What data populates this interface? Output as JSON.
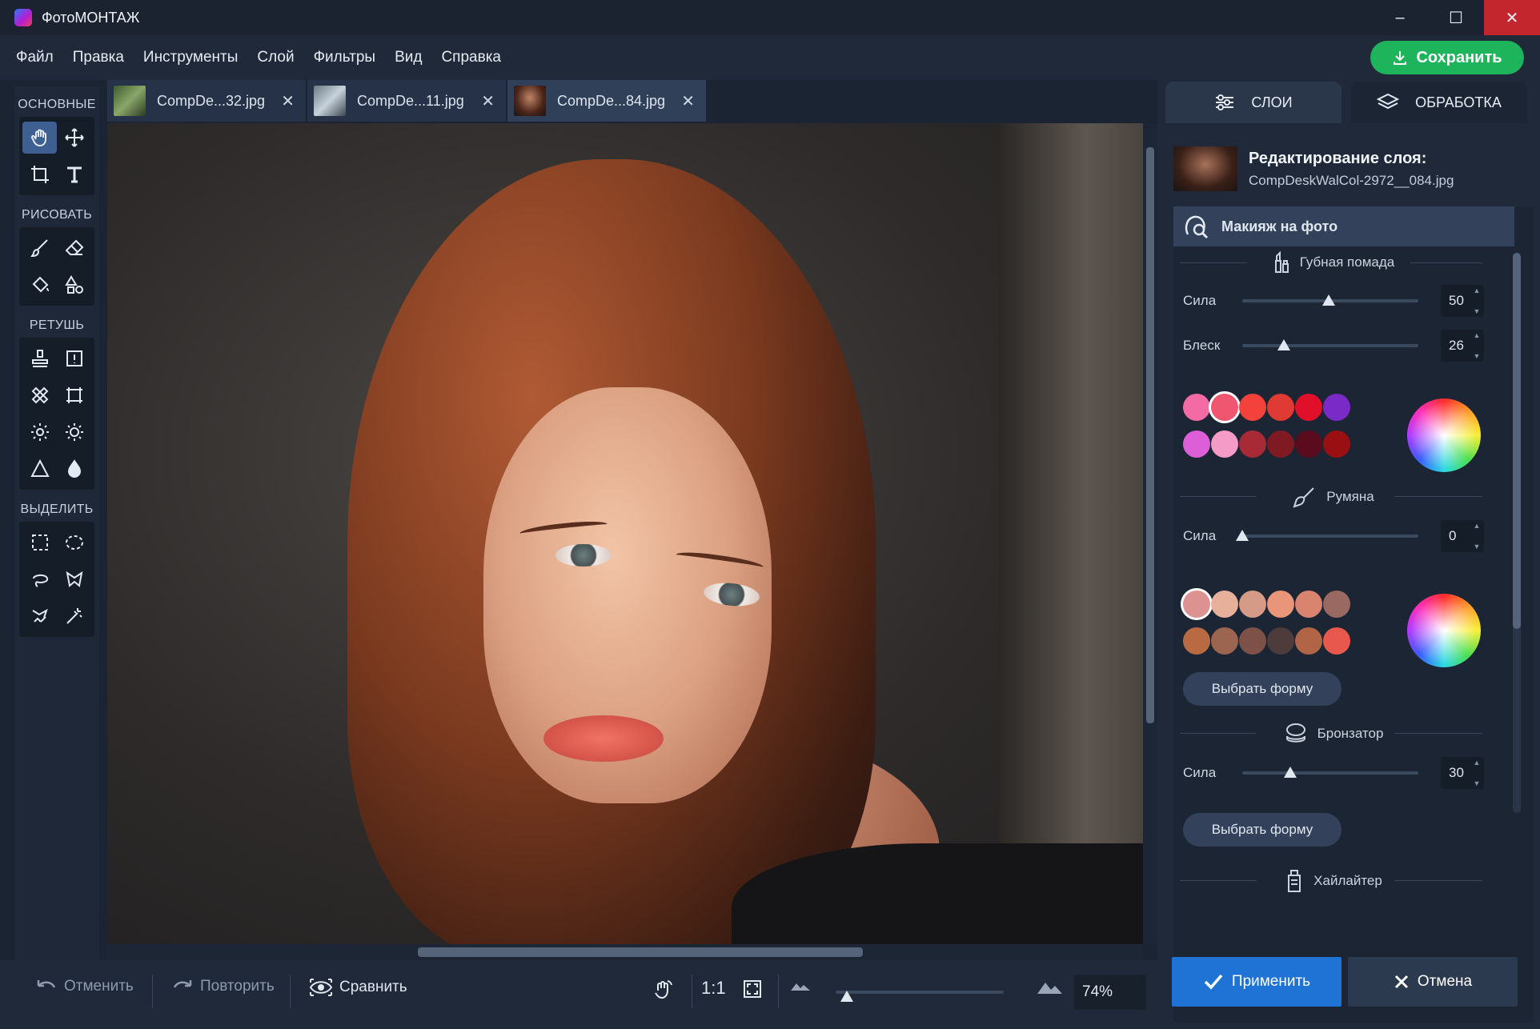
{
  "window": {
    "title": "ФотоМОНТАЖ"
  },
  "menu": [
    "Файл",
    "Правка",
    "Инструменты",
    "Слой",
    "Фильтры",
    "Вид",
    "Справка"
  ],
  "save_label": "Сохранить",
  "toolbar": {
    "sections": [
      "ОСНОВНЫЕ",
      "РИСОВАТЬ",
      "РЕТУШЬ",
      "ВЫДЕЛИТЬ"
    ]
  },
  "tabs": [
    {
      "label": "CompDe...32.jpg",
      "active": false
    },
    {
      "label": "CompDe...11.jpg",
      "active": false
    },
    {
      "label": "CompDe...84.jpg",
      "active": true
    }
  ],
  "bottom": {
    "undo": "Отменить",
    "redo": "Повторить",
    "compare": "Сравнить",
    "ratio": "1:1",
    "zoom": "74%"
  },
  "right_panel": {
    "tabs": [
      "СЛОИ",
      "ОБРАБОТКА"
    ],
    "layer_title": "Редактирование слоя:",
    "layer_file": "CompDeskWalCol-2972__084.jpg",
    "section_title": "Макияж на фото",
    "lipstick": {
      "title": "Губная помада",
      "strength_label": "Сила",
      "strength": "50",
      "gloss_label": "Блеск",
      "gloss": "26",
      "colors": [
        "#f46aa5",
        "#f0566f",
        "#f3413c",
        "#df3a33",
        "#e0102a",
        "#7a2ac7",
        "#dc5fd8",
        "#f59bc8",
        "#a82a36",
        "#7f1a22",
        "#5a0c1e",
        "#9a0f12"
      ],
      "selected": 1
    },
    "blush": {
      "title": "Румяна",
      "strength_label": "Сила",
      "strength": "0",
      "colors": [
        "#dd9292",
        "#e6b09b",
        "#d69b86",
        "#e8957a",
        "#d9846f",
        "#9a6a62",
        "#b96a42",
        "#9c6550",
        "#7e5148",
        "#4e3b3c",
        "#b26446",
        "#e9584d"
      ],
      "selected": 0,
      "shape_button": "Выбрать форму"
    },
    "bronzer": {
      "title": "Бронзатор",
      "strength_label": "Сила",
      "strength": "30",
      "shape_button": "Выбрать форму"
    },
    "highlighter": {
      "title": "Хайлайтер"
    }
  },
  "apply": "Применить",
  "cancel": "Отмена",
  "accent_colors": {
    "save": "#1eb45c",
    "apply": "#1f73d4",
    "close": "#c4262e"
  }
}
